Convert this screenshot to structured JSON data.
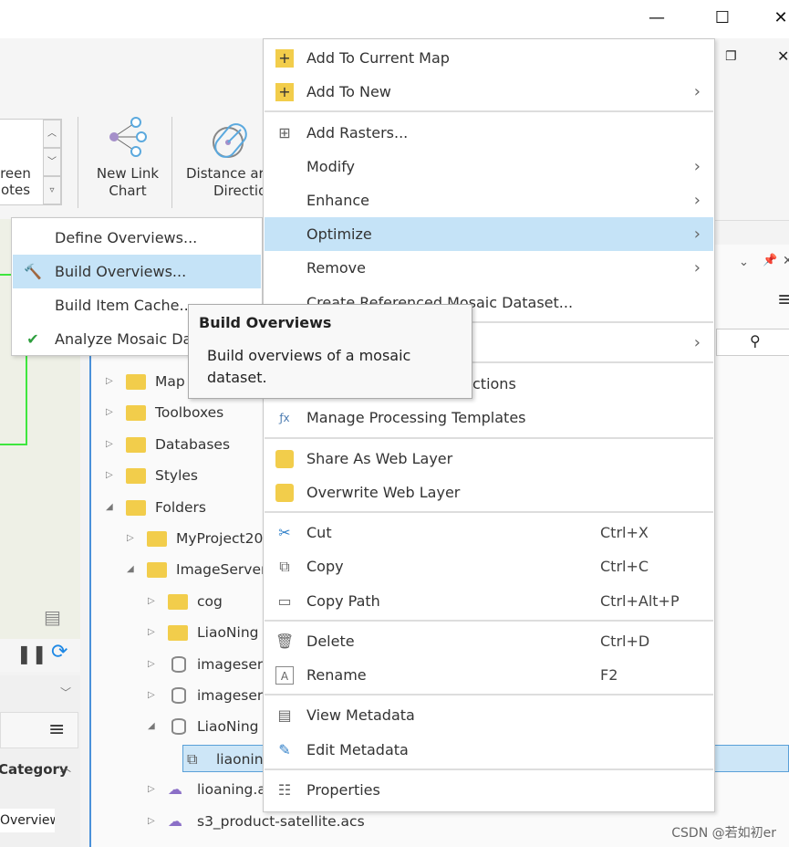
{
  "window": {
    "minimize": "—",
    "maximize": "☐",
    "close": "✕"
  },
  "ribbon": {
    "gallery_label": [
      "reen",
      "otes"
    ],
    "new_link_chart": [
      "New Link",
      "Chart"
    ],
    "distance_direction": [
      "Distance ar",
      "Direction"
    ]
  },
  "catalog": {
    "items": [
      {
        "label": "Map",
        "state": "collapsed"
      },
      {
        "label": "Toolboxes",
        "state": "collapsed"
      },
      {
        "label": "Databases",
        "state": "collapsed"
      },
      {
        "label": "Styles",
        "state": "collapsed"
      },
      {
        "label": "Folders",
        "state": "expanded"
      },
      {
        "label": "MyProject20",
        "state": "collapsed"
      },
      {
        "label": "ImageServer",
        "state": "expanded"
      },
      {
        "label": "cog",
        "state": "collapsed"
      },
      {
        "label": "LiaoNing",
        "state": "collapsed"
      },
      {
        "label": "imageser",
        "state": "collapsed"
      },
      {
        "label": "imageser",
        "state": "collapsed"
      },
      {
        "label": "LiaoNing",
        "state": "expanded"
      },
      {
        "label": "liaonin",
        "state": "selected"
      },
      {
        "label": "lioaning.a",
        "state": "collapsed"
      },
      {
        "label": "s3_product-satellite.acs",
        "state": "collapsed"
      }
    ]
  },
  "left_panel": {
    "category": "Category",
    "overview": "Overview",
    "overview_partial": "Overview"
  },
  "context_menu": {
    "items": {
      "add_current": "Add To Current Map",
      "add_new": "Add To New",
      "add_rasters": "Add Rasters...",
      "modify": "Modify",
      "enhance": "Enhance",
      "optimize": "Optimize",
      "remove": "Remove",
      "create_ref": "Create Referenced Mosaic Dataset...",
      "functions_partial": "ctions",
      "templates": "Manage Processing Templates",
      "share": "Share As Web Layer",
      "overwrite": "Overwrite Web Layer",
      "cut": "Cut",
      "copy": "Copy",
      "copy_path": "Copy Path",
      "delete": "Delete",
      "rename": "Rename",
      "view_meta": "View Metadata",
      "edit_meta": "Edit Metadata",
      "properties": "Properties"
    },
    "shortcuts": {
      "cut": "Ctrl+X",
      "copy": "Ctrl+C",
      "copy_path": "Ctrl+Alt+P",
      "delete": "Ctrl+D",
      "rename": "F2"
    },
    "highlighted": "Optimize"
  },
  "submenu": {
    "items": [
      "Define Overviews...",
      "Build Overviews...",
      "Build Item Cache...",
      "Analyze Mosaic Dat"
    ],
    "highlighted": "Build Overviews..."
  },
  "tooltip": {
    "title": "Build Overviews",
    "body": "Build overviews of a mosaic dataset."
  },
  "watermark": "CSDN @若如初er",
  "colors": {
    "highlight": "#c5e3f7",
    "folder": "#f2cd4b",
    "accent": "#4a90d9"
  }
}
